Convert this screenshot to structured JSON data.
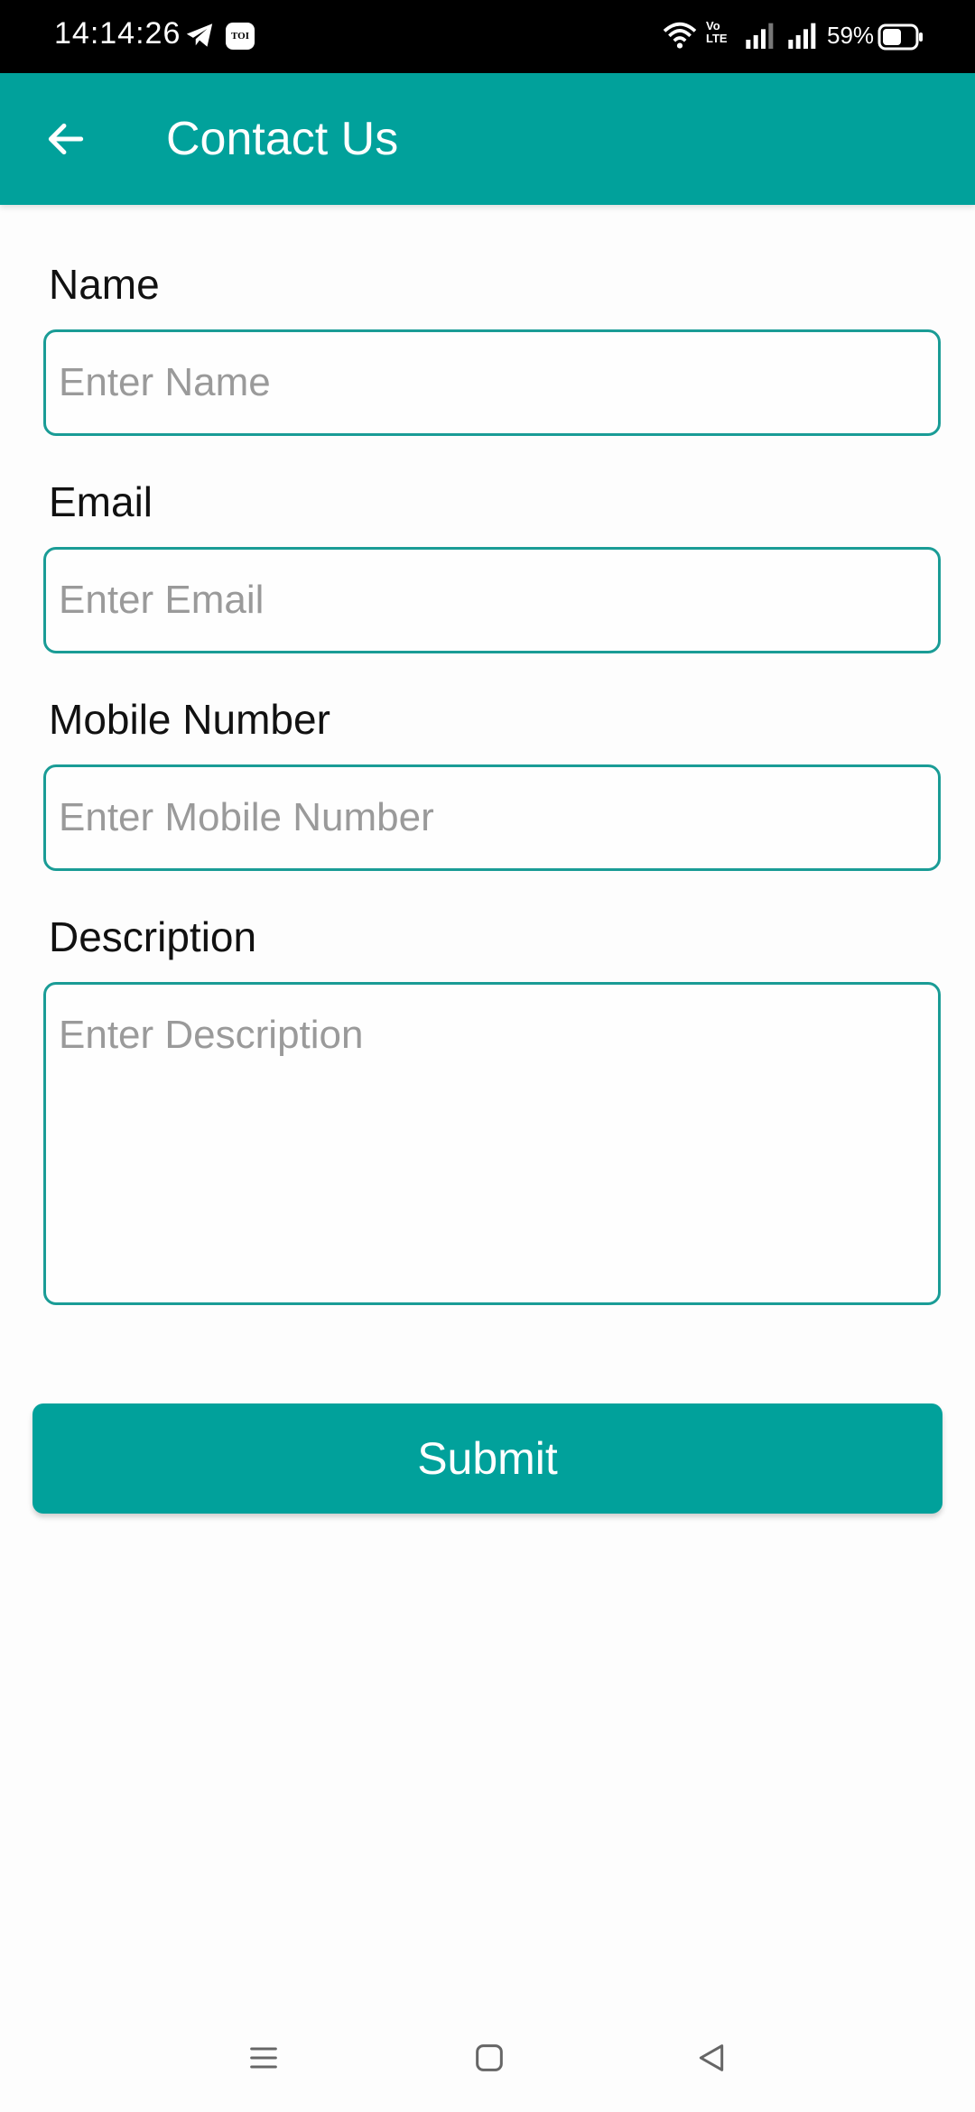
{
  "status_bar": {
    "time": "14:14:26",
    "toi_badge": "TOI",
    "volte_label": "Vo\nLTE",
    "battery_percent": "59%",
    "battery_level": 0.59,
    "icons": [
      "telegram-icon",
      "toi-icon",
      "wifi-icon",
      "volte-icon",
      "signal-icon",
      "signal-icon",
      "battery-icon"
    ]
  },
  "app_bar": {
    "title": "Contact Us",
    "back_icon": "arrow-left-icon",
    "background": "#01a19b"
  },
  "form": {
    "name": {
      "label": "Name",
      "placeholder": "Enter Name",
      "value": ""
    },
    "email": {
      "label": "Email",
      "placeholder": "Enter Email",
      "value": ""
    },
    "mobile": {
      "label": "Mobile Number",
      "placeholder": "Enter Mobile Number",
      "value": ""
    },
    "description": {
      "label": "Description",
      "placeholder": "Enter Description",
      "value": ""
    },
    "border_color": "#1a9c96"
  },
  "submit": {
    "label": "Submit",
    "color": "#01a19b"
  },
  "nav_bar": {
    "icons": [
      "menu-icon",
      "home-square-icon",
      "back-triangle-icon"
    ]
  }
}
